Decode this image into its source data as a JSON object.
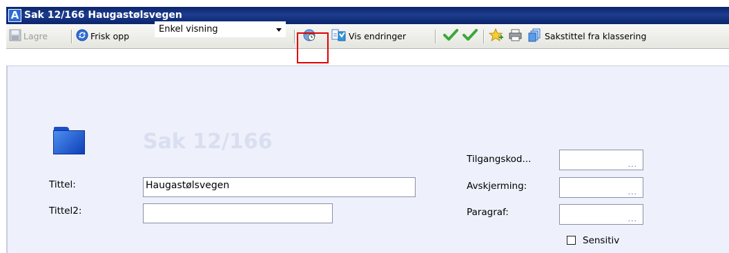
{
  "window": {
    "title": "Sak 12/166 Haugastølsvegen",
    "app_icon_letter": "A"
  },
  "toolbar": {
    "save_label": "Lagre",
    "refresh_label": "Frisk opp",
    "view_select_value": "Enkel visning",
    "show_changes_label": "Vis endringer",
    "case_title_label": "Sakstittel fra klassering"
  },
  "form": {
    "heading": "Sak 12/166",
    "title_label": "Tittel:",
    "title_value": "Haugastølsvegen",
    "title2_label": "Tittel2:",
    "title2_value": "",
    "access_code_label": "Tilgangskod...",
    "screening_label": "Avskjerming:",
    "paragraph_label": "Paragraf:",
    "sensitive_label": "Sensitiv",
    "ellipsis": "..."
  },
  "icons": [
    "save-icon",
    "refresh-icon",
    "dropdown-arrow-icon",
    "globe-clock-icon",
    "show-changes-icon",
    "checkmark-icon",
    "favorite-star-icon",
    "print-icon",
    "copy-documents-icon",
    "folder-icon"
  ],
  "colors": {
    "titlebar": "#0a246a",
    "highlight": "#e00000",
    "content_bg": "#eef0fb"
  }
}
